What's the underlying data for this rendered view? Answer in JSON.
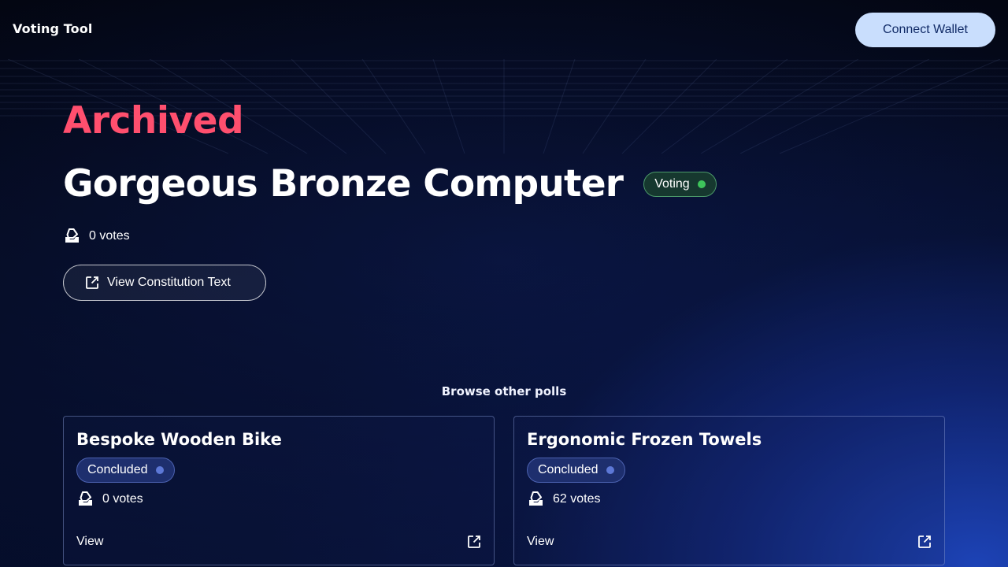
{
  "header": {
    "brand": "Voting Tool",
    "connect_label": "Connect Wallet"
  },
  "poll": {
    "archived_label": "Archived",
    "title": "Gorgeous Bronze Computer",
    "status": "Voting",
    "votes": "0 votes",
    "view_button_label": "View Constitution Text"
  },
  "browse": {
    "heading": "Browse other polls",
    "cards": [
      {
        "title": "Bespoke Wooden Bike",
        "status": "Concluded",
        "votes": "0 votes",
        "view_label": "View"
      },
      {
        "title": "Ergonomic Frozen Towels",
        "status": "Concluded",
        "votes": "62 votes",
        "view_label": "View"
      }
    ]
  },
  "colors": {
    "archived": "#ff4f6e",
    "connect_bg": "#c9defd",
    "voting_dot": "#3ec45b",
    "concluded_dot": "#5d78d6"
  },
  "icons": [
    "ballot-box-icon",
    "external-link-icon"
  ]
}
